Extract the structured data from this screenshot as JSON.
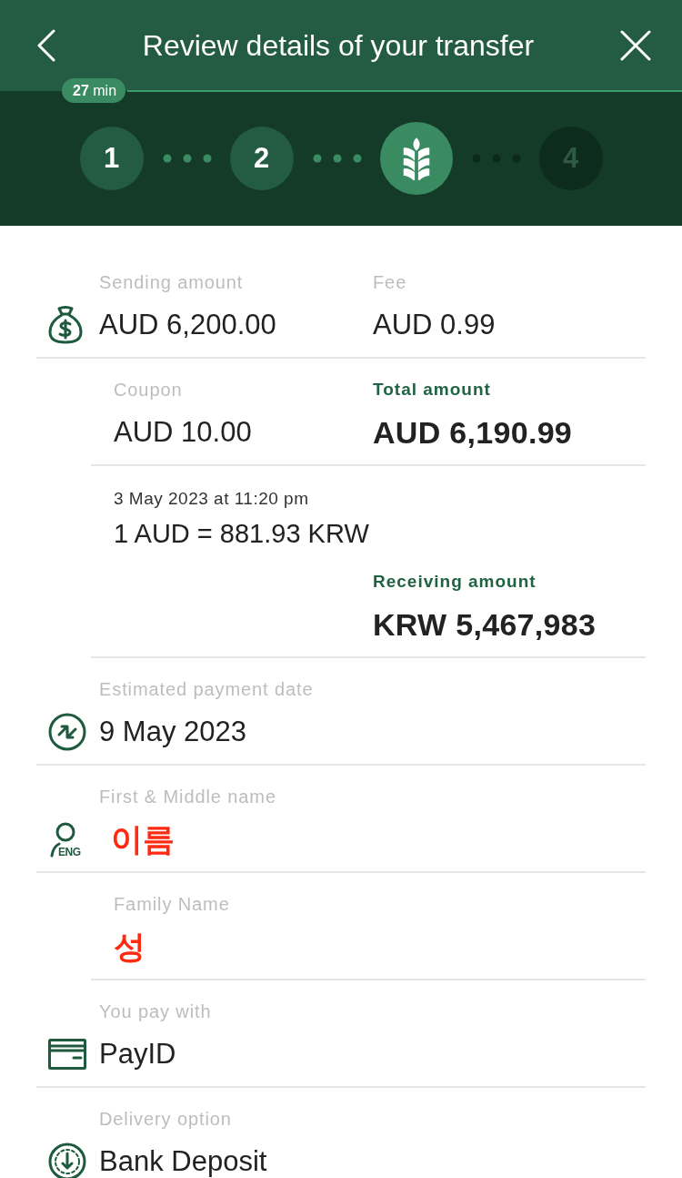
{
  "header": {
    "title": "Review details of your transfer"
  },
  "timer": {
    "text": "**27** min"
  },
  "steps": [
    {
      "kind": "number",
      "label": "1",
      "completed": true,
      "selected": false
    },
    {
      "kind": "number",
      "label": "2",
      "completed": true,
      "selected": false
    },
    {
      "kind": "icon",
      "completed": false,
      "selected": true
    },
    {
      "kind": "number",
      "label": "4",
      "completed": false,
      "selected": false
    }
  ],
  "sections": [
    {
      "kind": "amount",
      "fields": [
        {
          "label": "Sending amount",
          "value": "AUD 6,200.00",
          "kind": "plain"
        },
        {
          "label": "Fee",
          "value": "AUD 0.99",
          "kind": "plain"
        }
      ]
    },
    {
      "kind": "detail",
      "fields": [
        {
          "label": "Coupon",
          "value": "AUD 10.00",
          "kind": "plain"
        },
        {
          "label": "Total amount",
          "value": "AUD 6,190.99",
          "kind": "total"
        }
      ]
    },
    {
      "kind": "rate",
      "timestamp": "3 May 2023 at 11:20 pm",
      "rate": "1 AUD = 881.93 KRW",
      "fields": [
        {
          "label": "Receiving amount",
          "value": "KRW 5,467,983",
          "kind": "total"
        }
      ]
    },
    {
      "kind": "date",
      "fields": [
        {
          "label": "Estimated payment date",
          "value": "9 May 2023",
          "kind": "plain"
        }
      ]
    },
    {
      "kind": "recipient",
      "icon_text": "ENG",
      "fields": [
        {
          "label": "First & Middle name",
          "value": "이름",
          "kind": "highlighted"
        }
      ]
    },
    {
      "kind": "detail",
      "fields": [
        {
          "label": "Family Name",
          "value": "성",
          "kind": "highlighted"
        }
      ]
    },
    {
      "kind": "payment",
      "fields": [
        {
          "label": "You pay with",
          "value": "PayID",
          "kind": "plain"
        }
      ]
    },
    {
      "kind": "delivery",
      "fields": [
        {
          "label": "Delivery option",
          "value": "Bank Deposit",
          "kind": "plain"
        }
      ]
    }
  ]
}
